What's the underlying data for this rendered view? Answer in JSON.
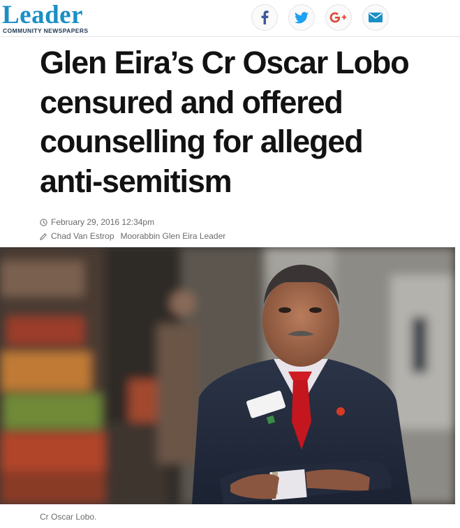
{
  "brand": {
    "name": "Leader",
    "subtitle": "COMMUNITY NEWSPAPERS",
    "color": "#1a8fc5"
  },
  "share": {
    "icons": [
      "facebook-icon",
      "twitter-icon",
      "google-plus-icon",
      "email-icon"
    ],
    "colors": {
      "facebook": "#3b5998",
      "twitter": "#1da1f2",
      "google_plus": "#dd4b39",
      "email": "#1a8fc5"
    }
  },
  "article": {
    "headline_lines": [
      "Glen Eira’s Cr Oscar Lobo",
      "censured and offered",
      "counselling for alleged",
      "anti-semitism"
    ],
    "date": "February 29, 2016 12:34pm",
    "author": "Chad Van Estrop",
    "publication": "Moorabbin Glen Eira Leader",
    "image_caption": "Cr Oscar Lobo."
  }
}
